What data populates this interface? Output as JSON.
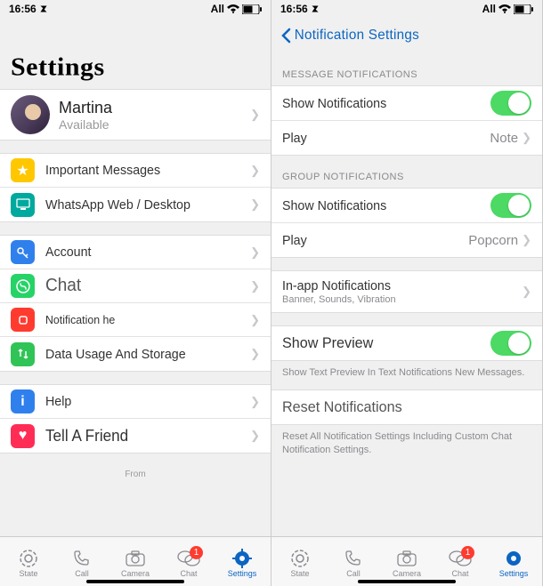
{
  "status": {
    "time": "16:56",
    "right_text": "All"
  },
  "left": {
    "title": "Settings",
    "profile": {
      "name": "Martina",
      "status": "Available"
    },
    "g1": [
      {
        "icon": "star-icon",
        "color": "c-yellow",
        "label": "Important Messages"
      },
      {
        "icon": "desktop-icon",
        "color": "c-teal",
        "label": "WhatsApp Web / Desktop"
      }
    ],
    "g2": [
      {
        "icon": "key-icon",
        "color": "c-blue",
        "label": "Account"
      },
      {
        "icon": "whatsapp-icon",
        "color": "c-green",
        "label": "Chat",
        "big": true
      },
      {
        "icon": "bell-icon",
        "color": "c-red",
        "label": "Notification he"
      },
      {
        "icon": "arrows-icon",
        "color": "c-greenalt",
        "label": "Data Usage And Storage"
      }
    ],
    "g3": [
      {
        "icon": "info-icon",
        "color": "c-bluei",
        "label": "Help"
      },
      {
        "icon": "heart-icon",
        "color": "c-pink",
        "label": "Tell A Friend"
      }
    ],
    "footer": "From"
  },
  "right": {
    "nav_title": "Notification Settings",
    "sec1_header": "MESSAGE NOTIFICATIONS",
    "sec1": {
      "show": "Show Notifications",
      "play": "Play",
      "play_val": "Note"
    },
    "sec2_header": "GROUP NOTIFICATIONS",
    "sec2": {
      "show": "Show Notifications",
      "play": "Play",
      "play_val": "Popcorn"
    },
    "inapp": {
      "title": "In-app Notifications",
      "sub": "Banner, Sounds, Vibration"
    },
    "preview": {
      "title": "Show Preview",
      "desc": "Show Text Preview In Text Notifications New Messages."
    },
    "reset": {
      "title": "Reset Notifications",
      "desc": "Reset All Notification Settings Including Custom Chat Notification Settings."
    }
  },
  "tabs": {
    "state": "State",
    "call": "Call",
    "camera": "Camera",
    "chat": "Chat",
    "settings": "Settings",
    "chat_badge": "1"
  }
}
